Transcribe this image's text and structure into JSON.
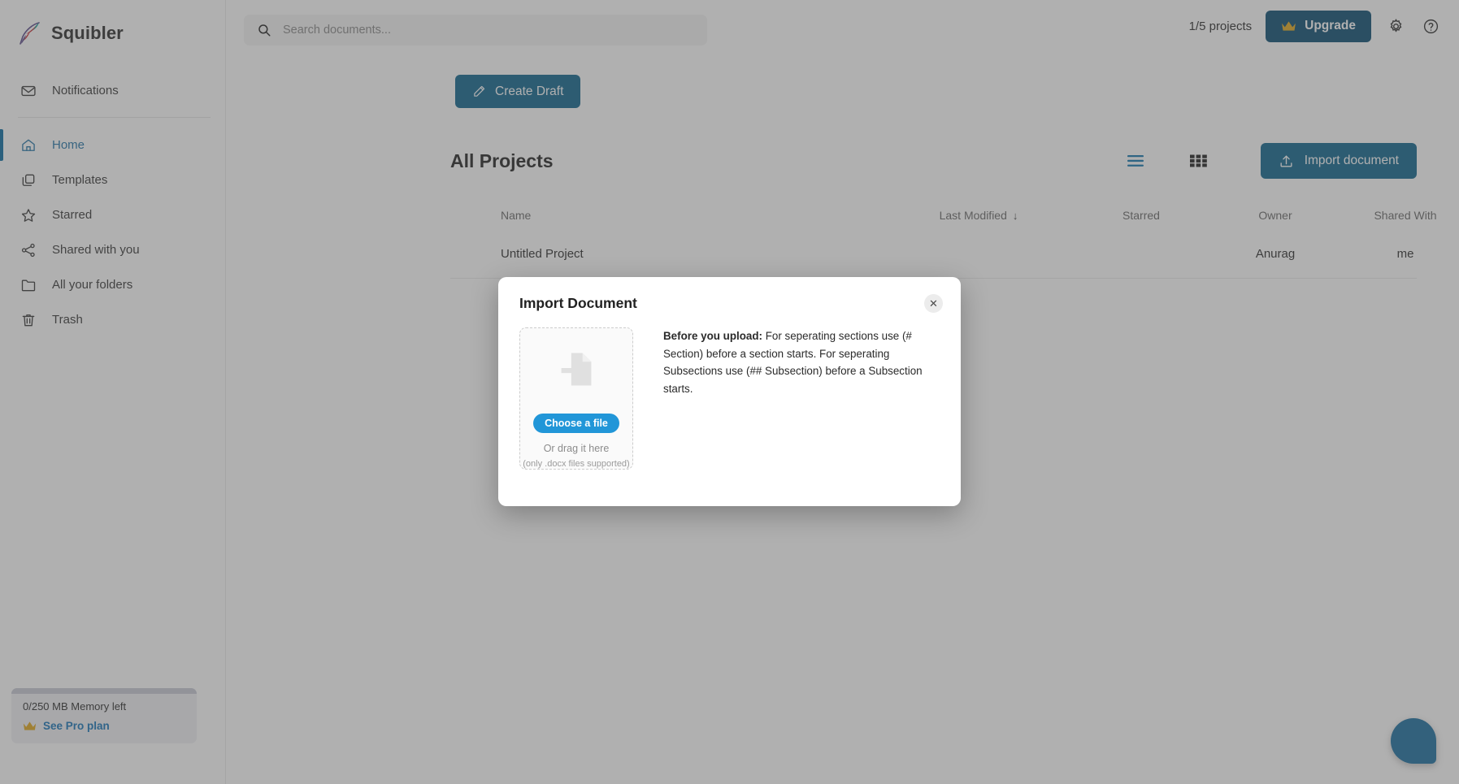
{
  "brand": {
    "name": "Squibler",
    "logo_icon": "feather-quill-icon"
  },
  "sidebar": {
    "notifications": {
      "label": "Notifications",
      "icon": "envelope-icon"
    },
    "items": [
      {
        "label": "Home",
        "icon": "home-icon",
        "active": true
      },
      {
        "label": "Templates",
        "icon": "copy-icon",
        "active": false
      },
      {
        "label": "Starred",
        "icon": "star-icon",
        "active": false
      },
      {
        "label": "Shared with you",
        "icon": "share-nodes-icon",
        "active": false
      },
      {
        "label": "All your folders",
        "icon": "folder-icon",
        "active": false
      },
      {
        "label": "Trash",
        "icon": "trash-icon",
        "active": false
      }
    ],
    "memory": {
      "text": "0/250 MB Memory left",
      "used_percent": 0,
      "pro_link": "See Pro plan",
      "crown_icon": "crown-icon"
    }
  },
  "header": {
    "search": {
      "placeholder": "Search documents...",
      "value": "",
      "icon": "search-icon"
    },
    "projects_count": "1/5 projects",
    "upgrade_label": "Upgrade",
    "upgrade_icon": "crown-icon",
    "settings_icon": "gear-icon",
    "help_icon": "question-circle-icon"
  },
  "main": {
    "create_draft_label": "Create Draft",
    "create_draft_icon": "pencil-icon",
    "section_title": "All Projects",
    "list_view_icon": "list-view-icon",
    "grid_view_icon": "grid-view-icon",
    "active_view": "list",
    "import_label": "Import document",
    "import_icon": "upload-icon",
    "table": {
      "columns": [
        "Name",
        "Last Modified",
        "Starred",
        "Owner",
        "Shared With"
      ],
      "sort_column": "Last Modified",
      "sort_arrow": "↓",
      "rows": [
        {
          "name": "Untitled Project",
          "last_modified": "",
          "starred": "",
          "owner": "Anurag",
          "shared_with": "me",
          "menu_icon": "kebab-menu-icon"
        }
      ]
    },
    "support_bubble_icon": "chat-bubble-icon"
  },
  "modal": {
    "title": "Import Document",
    "close_icon": "close-icon",
    "dropzone": {
      "icon": "file-import-icon",
      "choose_file_label": "Choose a file",
      "drag_hint": "Or drag it here",
      "supported_note": "(only .docx files supported)"
    },
    "note_label": "Before you upload:",
    "note_body": " For seperating sections use (# Section) before a section starts. For seperating Subsections use (## Subsection) before a Subsection starts."
  },
  "colors": {
    "brand_blue": "#11678f",
    "upgrade_blue": "#0d4f74",
    "accent_blue": "#2196d8",
    "active_nav": "#2576a8",
    "crown_gold": "#e0a81f"
  }
}
